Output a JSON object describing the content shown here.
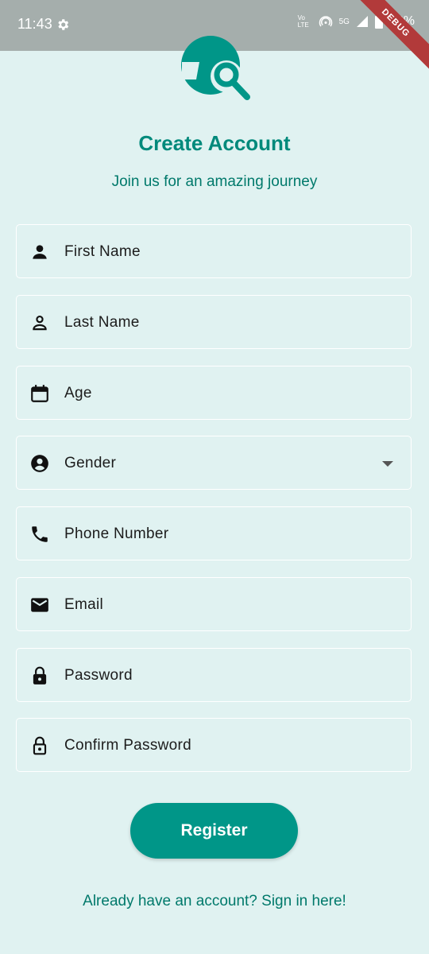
{
  "status_bar": {
    "time": "11:43",
    "network": "5G",
    "volte": "Vo LTE",
    "battery": "93%",
    "debug_banner": "DEBUG"
  },
  "header": {
    "title": "Create Account",
    "subtitle": "Join us for an amazing journey"
  },
  "form": {
    "first_name": {
      "label": "First Name",
      "icon": "person-icon"
    },
    "last_name": {
      "label": "Last Name",
      "icon": "person-outline-icon"
    },
    "age": {
      "label": "Age",
      "icon": "calendar-icon"
    },
    "gender": {
      "label": "Gender",
      "icon": "account-circle-icon"
    },
    "phone": {
      "label": "Phone Number",
      "icon": "phone-icon"
    },
    "email": {
      "label": "Email",
      "icon": "mail-icon"
    },
    "password": {
      "label": "Password",
      "icon": "lock-icon"
    },
    "confirm_password": {
      "label": "Confirm Password",
      "icon": "lock-outline-icon"
    }
  },
  "actions": {
    "register": "Register",
    "signin": "Already have an account? Sign in here!"
  },
  "colors": {
    "background": "#e0f2f1",
    "primary": "#009688",
    "title": "#00897b",
    "text_accent": "#00796b",
    "status_bar": "#a5aeac"
  }
}
